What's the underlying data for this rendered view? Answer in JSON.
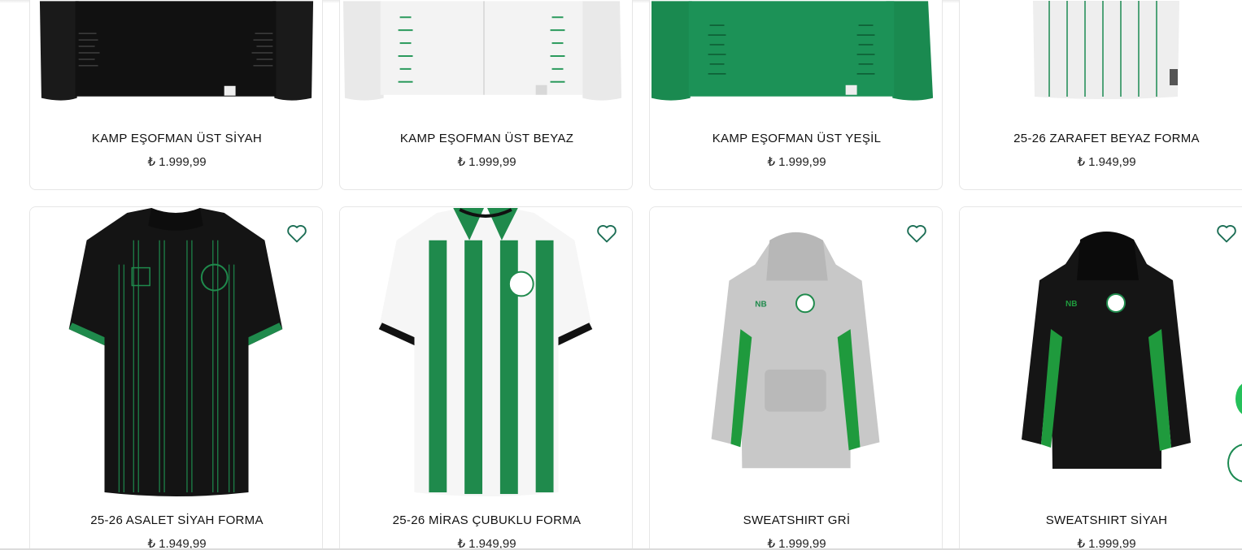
{
  "products_top": [
    {
      "name": "KAMP EŞOFMAN ÜST SİYAH",
      "price": "₺ 1.999,99",
      "color": "#151515"
    },
    {
      "name": "KAMP EŞOFMAN ÜST BEYAZ",
      "price": "₺ 1.999,99",
      "color": "#f2f2f2"
    },
    {
      "name": "KAMP EŞOFMAN ÜST YEŞİL",
      "price": "₺ 1.999,99",
      "color": "#1c8f55"
    },
    {
      "name": "25-26 ZARAFET BEYAZ FORMA",
      "price": "₺ 1.949,99",
      "color": "#efefef"
    }
  ],
  "products_bottom": [
    {
      "name": "25-26 ASALET SİYAH FORMA",
      "price": "₺ 1.949,99",
      "color": "#141414"
    },
    {
      "name": "25-26 MİRAS ÇUBUKLU FORMA",
      "price": "₺ 1.949,99",
      "color": "#1f8a4c"
    },
    {
      "name": "SWEATSHIRT GRİ",
      "price": "₺ 1.999,99",
      "color": "#c9c9c9"
    },
    {
      "name": "SWEATSHIRT SİYAH",
      "price": "₺ 1.999,99",
      "color": "#141414"
    }
  ],
  "favorite_icon": "heart-outline-icon",
  "accent_color": "#1c8a52",
  "scroll_icon": "chevron-up-icon",
  "scroll_glyph": "⌃"
}
